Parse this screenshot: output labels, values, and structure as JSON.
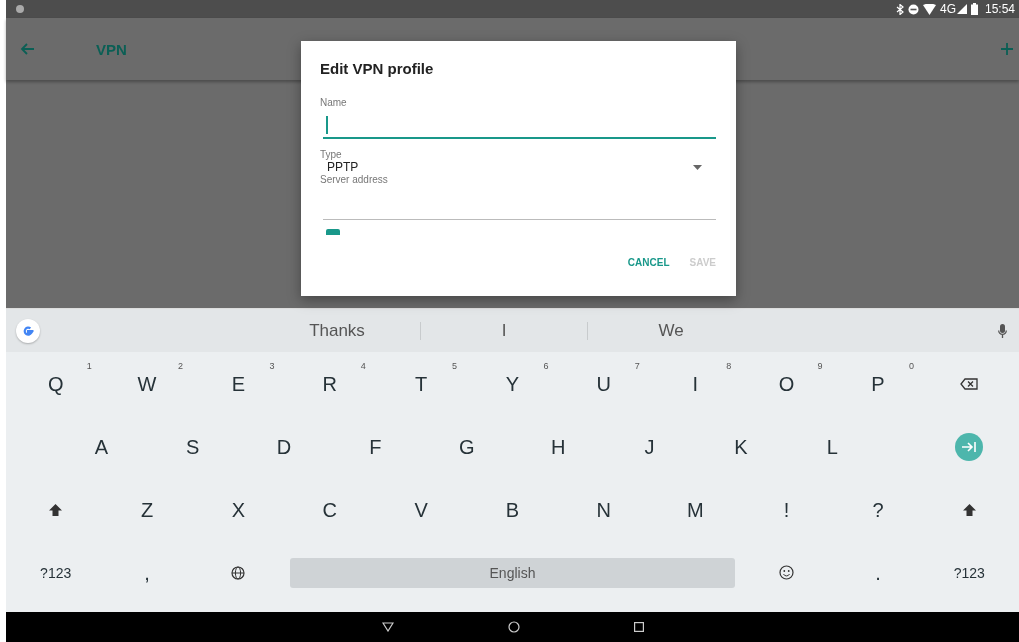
{
  "status_bar": {
    "time": "15:54",
    "network": "4G"
  },
  "app_bar": {
    "title": "VPN"
  },
  "dialog": {
    "title": "Edit VPN profile",
    "fields": [
      {
        "kind": "text",
        "label": "Name",
        "focused": true
      },
      {
        "kind": "dropdown",
        "label": "Type",
        "value": "PPTP"
      },
      {
        "kind": "text",
        "label": "Server address"
      },
      {
        "kind": "checkbox",
        "checked": true
      }
    ],
    "buttons": [
      {
        "label": "CANCEL",
        "disabled": false
      },
      {
        "label": "SAVE",
        "disabled": true
      }
    ]
  },
  "keyboard": {
    "suggestions": [
      "Thanks",
      "I",
      "We"
    ],
    "rows": [
      {
        "keys": [
          {
            "kind": "letter",
            "label": "Q",
            "hint": "1"
          },
          {
            "kind": "letter",
            "label": "W",
            "hint": "2"
          },
          {
            "kind": "letter",
            "label": "E",
            "hint": "3"
          },
          {
            "kind": "letter",
            "label": "R",
            "hint": "4"
          },
          {
            "kind": "letter",
            "label": "T",
            "hint": "5"
          },
          {
            "kind": "letter",
            "label": "Y",
            "hint": "6"
          },
          {
            "kind": "letter",
            "label": "U",
            "hint": "7"
          },
          {
            "kind": "letter",
            "label": "I",
            "hint": "8"
          },
          {
            "kind": "letter",
            "label": "O",
            "hint": "9"
          },
          {
            "kind": "letter",
            "label": "P",
            "hint": "0"
          },
          {
            "kind": "backspace"
          }
        ]
      },
      {
        "keys": [
          {
            "kind": "spacer"
          },
          {
            "kind": "letter",
            "label": "A"
          },
          {
            "kind": "letter",
            "label": "S"
          },
          {
            "kind": "letter",
            "label": "D"
          },
          {
            "kind": "letter",
            "label": "F"
          },
          {
            "kind": "letter",
            "label": "G"
          },
          {
            "kind": "letter",
            "label": "H"
          },
          {
            "kind": "letter",
            "label": "J"
          },
          {
            "kind": "letter",
            "label": "K"
          },
          {
            "kind": "letter",
            "label": "L"
          },
          {
            "kind": "spacer"
          },
          {
            "kind": "enter"
          }
        ]
      },
      {
        "keys": [
          {
            "kind": "shift"
          },
          {
            "kind": "letter",
            "label": "Z"
          },
          {
            "kind": "letter",
            "label": "X"
          },
          {
            "kind": "letter",
            "label": "C"
          },
          {
            "kind": "letter",
            "label": "V"
          },
          {
            "kind": "letter",
            "label": "B"
          },
          {
            "kind": "letter",
            "label": "N"
          },
          {
            "kind": "letter",
            "label": "M"
          },
          {
            "kind": "letter",
            "label": "!"
          },
          {
            "kind": "letter",
            "label": "?"
          },
          {
            "kind": "shift"
          }
        ]
      },
      {
        "keys": [
          {
            "kind": "small",
            "label": "?123"
          },
          {
            "kind": "letter",
            "label": ","
          },
          {
            "kind": "globe"
          },
          {
            "kind": "space",
            "label": "English"
          },
          {
            "kind": "emoji"
          },
          {
            "kind": "letter",
            "label": "."
          },
          {
            "kind": "small",
            "label": "?123"
          }
        ]
      }
    ]
  }
}
